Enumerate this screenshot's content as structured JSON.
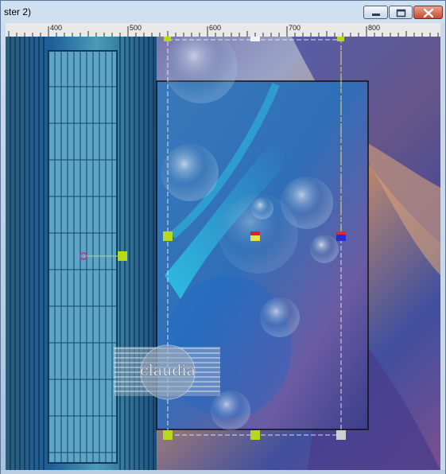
{
  "window": {
    "title": "ster 2)",
    "buttons": {
      "minimize_icon": "minimize-icon",
      "maximize_icon": "maximize-icon",
      "close_icon": "close-icon"
    }
  },
  "ruler": {
    "labels": [
      "400",
      "500",
      "600",
      "700",
      "800"
    ]
  },
  "canvas": {
    "watermark_text": "claudia",
    "background_colors": [
      "#1b3e6c",
      "#3a78c0",
      "#7aa9cf",
      "#c77f5f",
      "#6a4b8f"
    ],
    "handle_color": "#b7d81e"
  }
}
